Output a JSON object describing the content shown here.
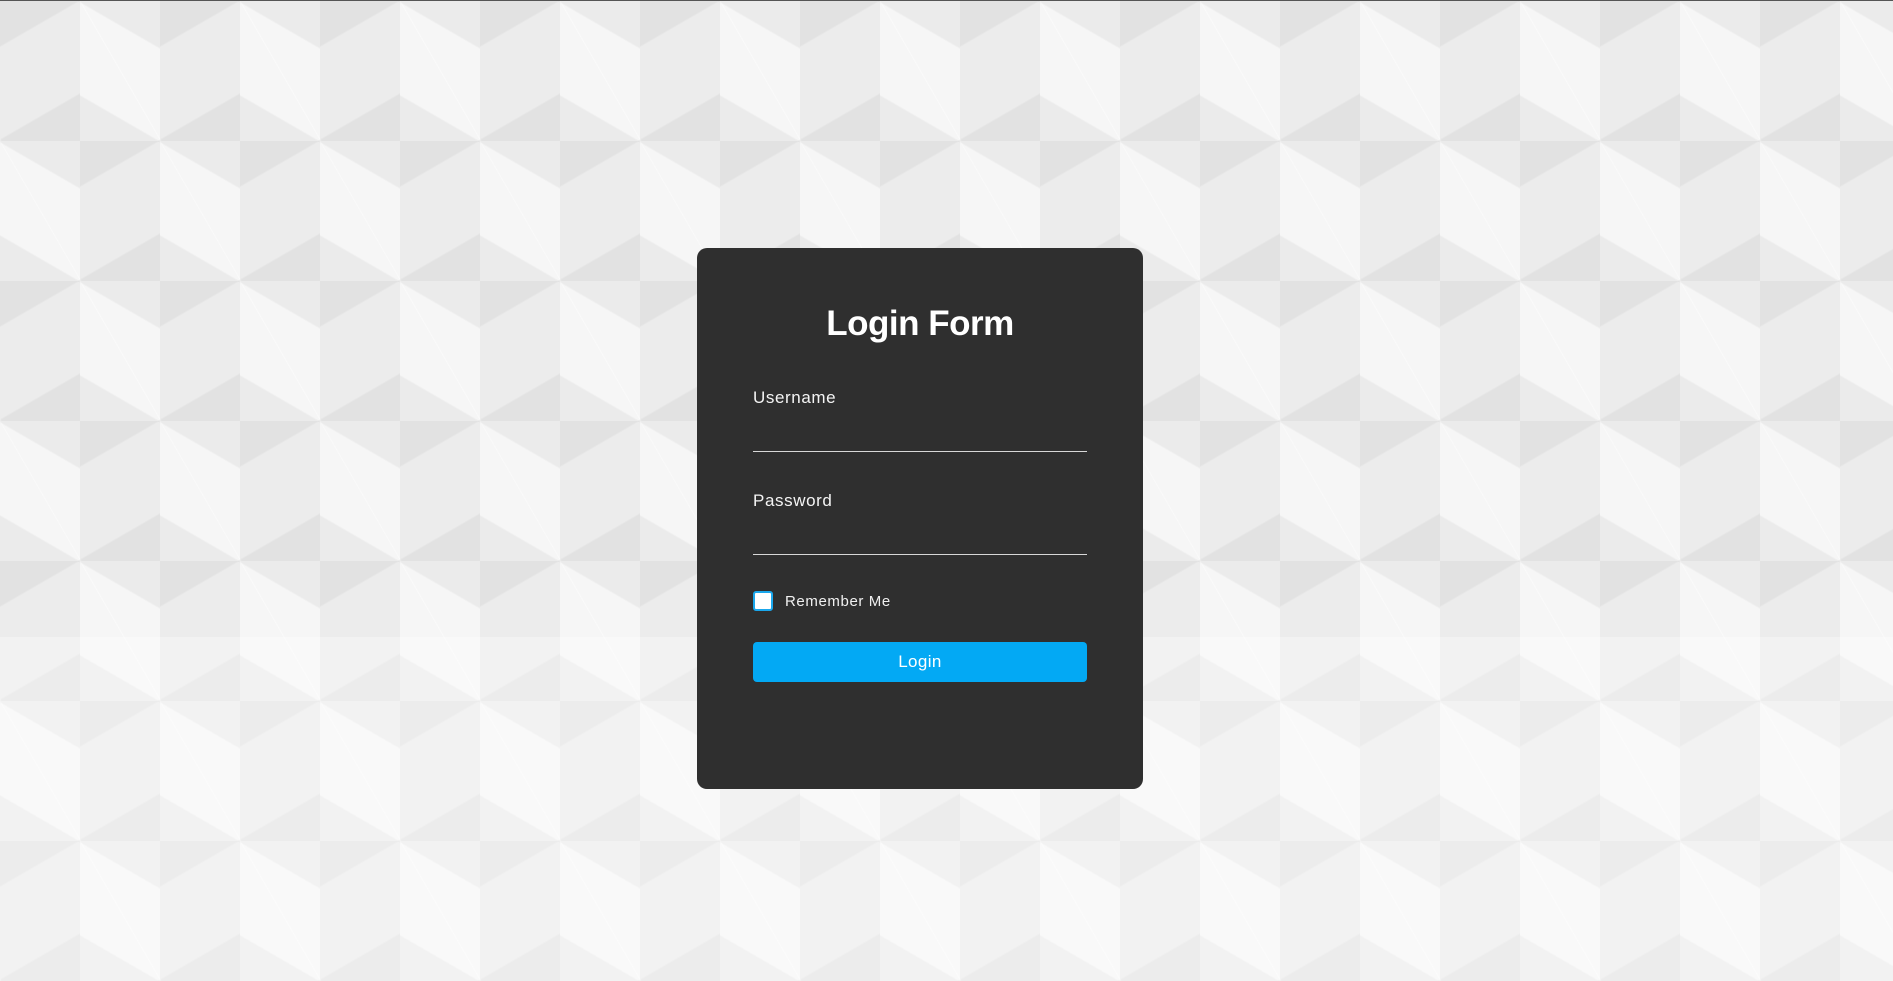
{
  "colors": {
    "card_background": "#2f2f2f",
    "accent": "#03a9f4",
    "page_background": "#ececec",
    "text": "#ffffff"
  },
  "form": {
    "title": "Login Form",
    "username": {
      "label": "Username",
      "value": "",
      "placeholder": ""
    },
    "password": {
      "label": "Password",
      "value": "",
      "placeholder": ""
    },
    "remember_me": {
      "label": "Remember Me",
      "checked": false
    },
    "submit_label": "Login"
  }
}
